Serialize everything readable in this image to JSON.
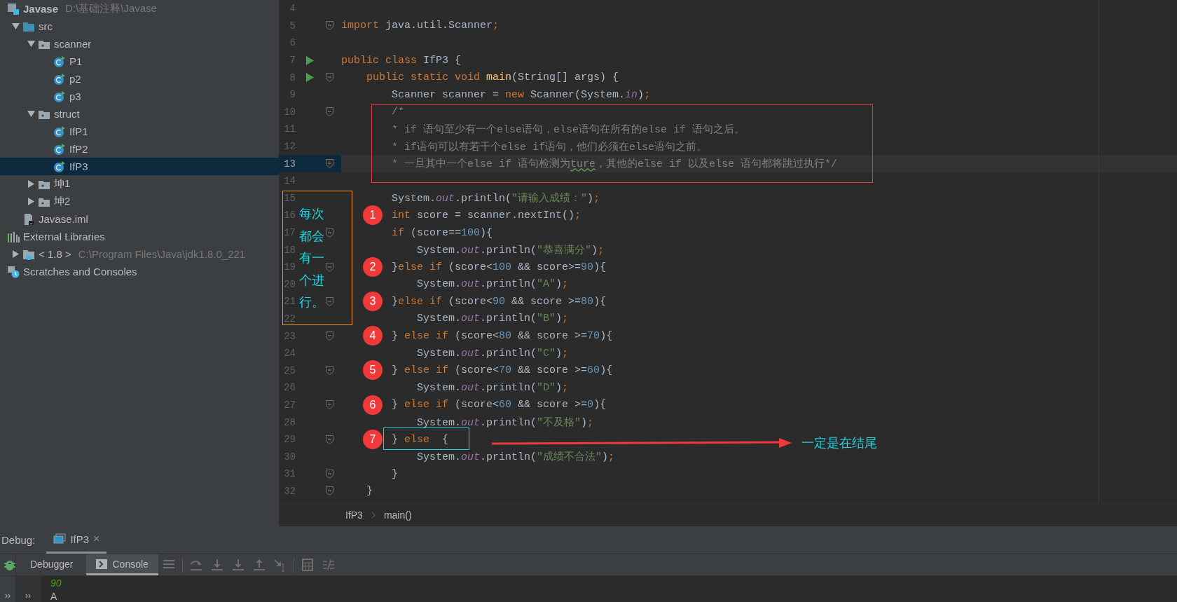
{
  "project_tree": [
    {
      "label": "Javase",
      "path": "D:\\基础注释\\Javase",
      "kind": "module",
      "selected": false,
      "children": [
        {
          "label": "src",
          "kind": "source-folder",
          "expanded": true,
          "selected": false,
          "children": [
            {
              "label": "scanner",
              "kind": "package",
              "expanded": true,
              "selected": false,
              "children": [
                {
                  "label": "P1",
                  "kind": "class",
                  "selected": false
                },
                {
                  "label": "p2",
                  "kind": "class",
                  "selected": false
                },
                {
                  "label": "p3",
                  "kind": "class",
                  "selected": false
                }
              ]
            },
            {
              "label": "struct",
              "kind": "package",
              "expanded": true,
              "selected": false,
              "children": [
                {
                  "label": "IfP1",
                  "kind": "class",
                  "selected": false
                },
                {
                  "label": "IfP2",
                  "kind": "class",
                  "selected": false
                },
                {
                  "label": "IfP3",
                  "kind": "class",
                  "selected": true
                }
              ]
            },
            {
              "label": "坤1",
              "kind": "package",
              "expanded": false,
              "selected": false
            },
            {
              "label": "坤2",
              "kind": "package",
              "expanded": false,
              "selected": false
            }
          ]
        },
        {
          "label": "Javase.iml",
          "kind": "file",
          "selected": false
        }
      ]
    },
    {
      "label": "External Libraries",
      "kind": "libraries",
      "selected": false,
      "children": [
        {
          "label": "< 1.8 >",
          "path": "C:\\Program Files\\Java\\jdk1.8.0_221",
          "kind": "sdk",
          "expanded": false,
          "selected": false
        }
      ]
    },
    {
      "label": "Scratches and Consoles",
      "kind": "scratches",
      "selected": false
    }
  ],
  "editor": {
    "lines": [
      {
        "number": "4"
      },
      {
        "number": "5",
        "fold": true,
        "tokens": [
          {
            "kind": "keyword",
            "text": "import "
          },
          {
            "kind": "plain",
            "text": "java.util.Scanner"
          },
          {
            "kind": "keyword",
            "text": ";"
          }
        ]
      },
      {
        "number": "6"
      },
      {
        "number": "7",
        "run": true,
        "tokens": [
          {
            "kind": "keyword",
            "text": "public class "
          },
          {
            "kind": "plain",
            "text": "IfP3 {"
          }
        ]
      },
      {
        "number": "8",
        "run": true,
        "fold": true,
        "tokens": [
          {
            "kind": "keyword",
            "text": "    public static void "
          },
          {
            "kind": "method",
            "text": "main"
          },
          {
            "kind": "plain",
            "text": "(String[] args) {"
          }
        ]
      },
      {
        "number": "9",
        "tokens": [
          {
            "kind": "plain",
            "text": "        Scanner scanner = "
          },
          {
            "kind": "keyword",
            "text": "new "
          },
          {
            "kind": "plain",
            "text": "Scanner(System."
          },
          {
            "kind": "field",
            "text": "in"
          },
          {
            "kind": "plain",
            "text": ")"
          },
          {
            "kind": "keyword",
            "text": ";"
          }
        ]
      },
      {
        "number": "10",
        "fold": true,
        "tokens": [
          {
            "kind": "comment",
            "text": "        /*"
          }
        ]
      },
      {
        "number": "11",
        "tokens": [
          {
            "kind": "comment",
            "text": "        * if 语句至少有一个else语句，else语句在所有的else if 语句之后。"
          }
        ]
      },
      {
        "number": "12",
        "tokens": [
          {
            "kind": "comment",
            "text": "        * if语句可以有若干个else if语句，他们必须在else语句之前。"
          }
        ]
      },
      {
        "number": "13",
        "current": true,
        "fold": true,
        "tokens": [
          {
            "kind": "comment",
            "text": "        * 一旦其中一个else if 语句检测为"
          },
          {
            "kind": "typo",
            "text": "ture"
          },
          {
            "kind": "comment",
            "text": "，其他的else if 以及else 语句都将跳过执行*/"
          }
        ]
      },
      {
        "number": "14"
      },
      {
        "number": "15",
        "tokens": [
          {
            "kind": "plain",
            "text": "        System."
          },
          {
            "kind": "field",
            "text": "out"
          },
          {
            "kind": "plain",
            "text": ".println("
          },
          {
            "kind": "string",
            "text": "\"请输入成绩：\""
          },
          {
            "kind": "plain",
            "text": ")"
          },
          {
            "kind": "keyword",
            "text": ";"
          }
        ]
      },
      {
        "number": "16",
        "badge": "1",
        "tokens": [
          {
            "kind": "keyword",
            "text": "        int "
          },
          {
            "kind": "plain",
            "text": "score = scanner.nextInt()"
          },
          {
            "kind": "keyword",
            "text": ";"
          }
        ]
      },
      {
        "number": "17",
        "fold": true,
        "tokens": [
          {
            "kind": "keyword",
            "text": "        if "
          },
          {
            "kind": "plain",
            "text": "(score=="
          },
          {
            "kind": "number",
            "text": "100"
          },
          {
            "kind": "plain",
            "text": "){"
          }
        ]
      },
      {
        "number": "18",
        "tokens": [
          {
            "kind": "plain",
            "text": "            System."
          },
          {
            "kind": "field",
            "text": "out"
          },
          {
            "kind": "plain",
            "text": ".println("
          },
          {
            "kind": "string",
            "text": "\"恭喜满分\""
          },
          {
            "kind": "plain",
            "text": ")"
          },
          {
            "kind": "keyword",
            "text": ";"
          }
        ]
      },
      {
        "number": "19",
        "badge": "2",
        "fold": true,
        "tokens": [
          {
            "kind": "plain",
            "text": "        }"
          },
          {
            "kind": "keyword",
            "text": "else if "
          },
          {
            "kind": "plain",
            "text": "(score<"
          },
          {
            "kind": "number",
            "text": "100"
          },
          {
            "kind": "plain",
            "text": " && score>="
          },
          {
            "kind": "number",
            "text": "90"
          },
          {
            "kind": "plain",
            "text": "){"
          }
        ]
      },
      {
        "number": "20",
        "tokens": [
          {
            "kind": "plain",
            "text": "            System."
          },
          {
            "kind": "field",
            "text": "out"
          },
          {
            "kind": "plain",
            "text": ".println("
          },
          {
            "kind": "string",
            "text": "\"A\""
          },
          {
            "kind": "plain",
            "text": ")"
          },
          {
            "kind": "keyword",
            "text": ";"
          }
        ]
      },
      {
        "number": "21",
        "badge": "3",
        "fold": true,
        "tokens": [
          {
            "kind": "plain",
            "text": "        }"
          },
          {
            "kind": "keyword",
            "text": "else if "
          },
          {
            "kind": "plain",
            "text": "(score<"
          },
          {
            "kind": "number",
            "text": "90"
          },
          {
            "kind": "plain",
            "text": " && score >="
          },
          {
            "kind": "number",
            "text": "80"
          },
          {
            "kind": "plain",
            "text": "){"
          }
        ]
      },
      {
        "number": "22",
        "tokens": [
          {
            "kind": "plain",
            "text": "            System."
          },
          {
            "kind": "field",
            "text": "out"
          },
          {
            "kind": "plain",
            "text": ".println("
          },
          {
            "kind": "string",
            "text": "\"B\""
          },
          {
            "kind": "plain",
            "text": ")"
          },
          {
            "kind": "keyword",
            "text": ";"
          }
        ]
      },
      {
        "number": "23",
        "badge": "4",
        "fold": true,
        "tokens": [
          {
            "kind": "plain",
            "text": "        } "
          },
          {
            "kind": "keyword",
            "text": "else if "
          },
          {
            "kind": "plain",
            "text": "(score<"
          },
          {
            "kind": "number",
            "text": "80"
          },
          {
            "kind": "plain",
            "text": " && score >="
          },
          {
            "kind": "number",
            "text": "70"
          },
          {
            "kind": "plain",
            "text": "){"
          }
        ]
      },
      {
        "number": "24",
        "tokens": [
          {
            "kind": "plain",
            "text": "            System."
          },
          {
            "kind": "field",
            "text": "out"
          },
          {
            "kind": "plain",
            "text": ".println("
          },
          {
            "kind": "string",
            "text": "\"C\""
          },
          {
            "kind": "plain",
            "text": ")"
          },
          {
            "kind": "keyword",
            "text": ";"
          }
        ]
      },
      {
        "number": "25",
        "badge": "5",
        "fold": true,
        "tokens": [
          {
            "kind": "plain",
            "text": "        } "
          },
          {
            "kind": "keyword",
            "text": "else if "
          },
          {
            "kind": "plain",
            "text": "(score<"
          },
          {
            "kind": "number",
            "text": "70"
          },
          {
            "kind": "plain",
            "text": " && score >="
          },
          {
            "kind": "number",
            "text": "60"
          },
          {
            "kind": "plain",
            "text": "){"
          }
        ]
      },
      {
        "number": "26",
        "tokens": [
          {
            "kind": "plain",
            "text": "            System."
          },
          {
            "kind": "field",
            "text": "out"
          },
          {
            "kind": "plain",
            "text": ".println("
          },
          {
            "kind": "string",
            "text": "\"D\""
          },
          {
            "kind": "plain",
            "text": ")"
          },
          {
            "kind": "keyword",
            "text": ";"
          }
        ]
      },
      {
        "number": "27",
        "badge": "6",
        "fold": true,
        "tokens": [
          {
            "kind": "plain",
            "text": "        } "
          },
          {
            "kind": "keyword",
            "text": "else if "
          },
          {
            "kind": "plain",
            "text": "(score<"
          },
          {
            "kind": "number",
            "text": "60"
          },
          {
            "kind": "plain",
            "text": " && score >="
          },
          {
            "kind": "number",
            "text": "0"
          },
          {
            "kind": "plain",
            "text": "){"
          }
        ]
      },
      {
        "number": "28",
        "tokens": [
          {
            "kind": "plain",
            "text": "            System."
          },
          {
            "kind": "field",
            "text": "out"
          },
          {
            "kind": "plain",
            "text": ".println("
          },
          {
            "kind": "string",
            "text": "\"不及格\""
          },
          {
            "kind": "plain",
            "text": ")"
          },
          {
            "kind": "keyword",
            "text": ";"
          }
        ]
      },
      {
        "number": "29",
        "badge": "7",
        "fold": true,
        "tokens": [
          {
            "kind": "plain",
            "text": "        } "
          },
          {
            "kind": "keyword",
            "text": "else  "
          },
          {
            "kind": "plain",
            "text": "{"
          }
        ]
      },
      {
        "number": "30",
        "tokens": [
          {
            "kind": "plain",
            "text": "            System."
          },
          {
            "kind": "field",
            "text": "out"
          },
          {
            "kind": "plain",
            "text": ".println("
          },
          {
            "kind": "string",
            "text": "\"成绩不合法\""
          },
          {
            "kind": "plain",
            "text": ")"
          },
          {
            "kind": "keyword",
            "text": ";"
          }
        ]
      },
      {
        "number": "31",
        "fold": true,
        "tokens": [
          {
            "kind": "plain",
            "text": "        }"
          }
        ]
      },
      {
        "number": "32",
        "fold": true,
        "tokens": [
          {
            "kind": "plain",
            "text": "    }"
          }
        ]
      }
    ],
    "side_note": "每次都会有一个进行。",
    "arrow_note": "一定是在结尾"
  },
  "breadcrumb": [
    "IfP3",
    "main()"
  ],
  "debug": {
    "label": "Debug:",
    "tabs": [
      {
        "label": "IfP3",
        "close": "×",
        "selected": true
      }
    ],
    "expand_buttons": [
      "››",
      "››"
    ],
    "subtabs": [
      {
        "label": "Debugger",
        "selected": false
      },
      {
        "label": "Console",
        "selected": true
      }
    ],
    "console": [
      {
        "kind": "input",
        "text": "90"
      },
      {
        "kind": "output",
        "text": "A"
      }
    ]
  }
}
